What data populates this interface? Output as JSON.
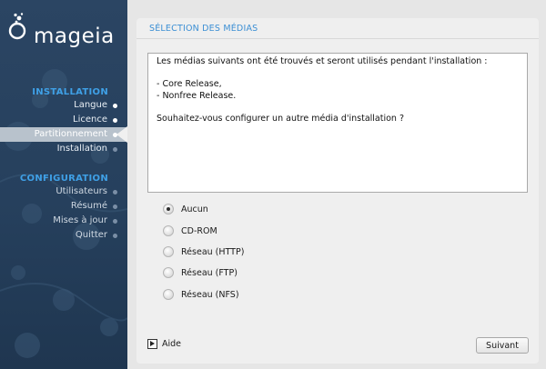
{
  "brand": {
    "name": "mageia"
  },
  "sidebar": {
    "sections": [
      {
        "title": "INSTALLATION",
        "items": [
          {
            "label": "Langue",
            "state": "done"
          },
          {
            "label": "Licence",
            "state": "done"
          },
          {
            "label": "Partitionnement",
            "state": "active"
          },
          {
            "label": "Installation",
            "state": "pending"
          }
        ]
      },
      {
        "title": "CONFIGURATION",
        "items": [
          {
            "label": "Utilisateurs",
            "state": "pending"
          },
          {
            "label": "Résumé",
            "state": "pending"
          },
          {
            "label": "Mises à jour",
            "state": "pending"
          },
          {
            "label": "Quitter",
            "state": "pending"
          }
        ]
      }
    ]
  },
  "main": {
    "title": "SÉLECTION DES MÉDIAS",
    "message_lines": [
      "Les médias suivants ont été trouvés et seront utilisés pendant l'installation :",
      "",
      "- Core Release,",
      "- Nonfree Release.",
      "",
      "Souhaitez-vous configurer un autre média d'installation ?"
    ],
    "options": [
      {
        "label": "Aucun",
        "checked": true
      },
      {
        "label": "CD-ROM",
        "checked": false
      },
      {
        "label": "Réseau (HTTP)",
        "checked": false
      },
      {
        "label": "Réseau (FTP)",
        "checked": false
      },
      {
        "label": "Réseau (NFS)",
        "checked": false
      }
    ]
  },
  "footer": {
    "help_label": "Aide",
    "next_label": "Suivant"
  },
  "colors": {
    "sidebar_bg": "#26405d",
    "section_title": "#3fa0e6",
    "page_title": "#3c8fd4",
    "panel_bg": "#efefef"
  }
}
